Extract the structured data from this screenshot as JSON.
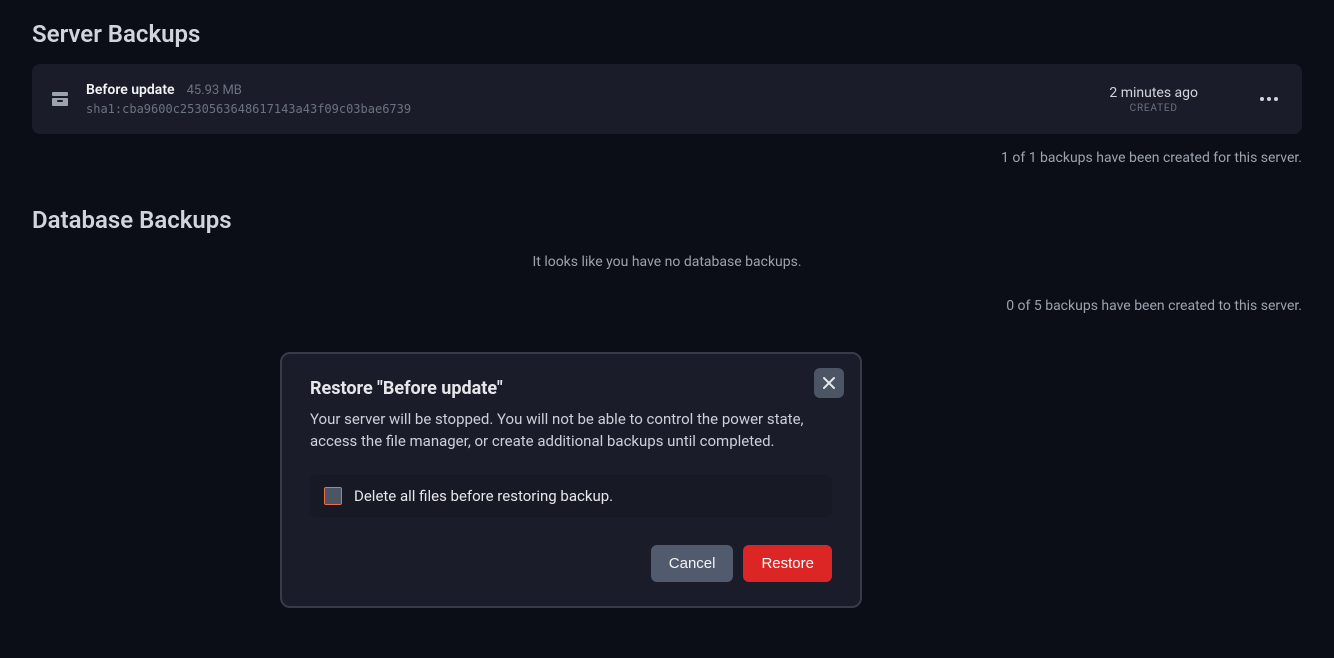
{
  "server_backups": {
    "title": "Server Backups",
    "items": [
      {
        "name": "Before update",
        "size": "45.93 MB",
        "hash": "sha1:cba9600c2530563648617143a43f09c03bae6739",
        "time_ago": "2 minutes ago",
        "time_label": "CREATED"
      }
    ],
    "status": "1 of 1 backups have been created for this server."
  },
  "database_backups": {
    "title": "Database Backups",
    "empty_message": "It looks like you have no database backups.",
    "status": "0 of 5 backups have been created to this server."
  },
  "modal": {
    "title": "Restore \"Before update\"",
    "body": "Your server will be stopped. You will not be able to control the power state, access the file manager, or create additional backups until completed.",
    "checkbox_label": "Delete all files before restoring backup.",
    "cancel_label": "Cancel",
    "confirm_label": "Restore"
  }
}
